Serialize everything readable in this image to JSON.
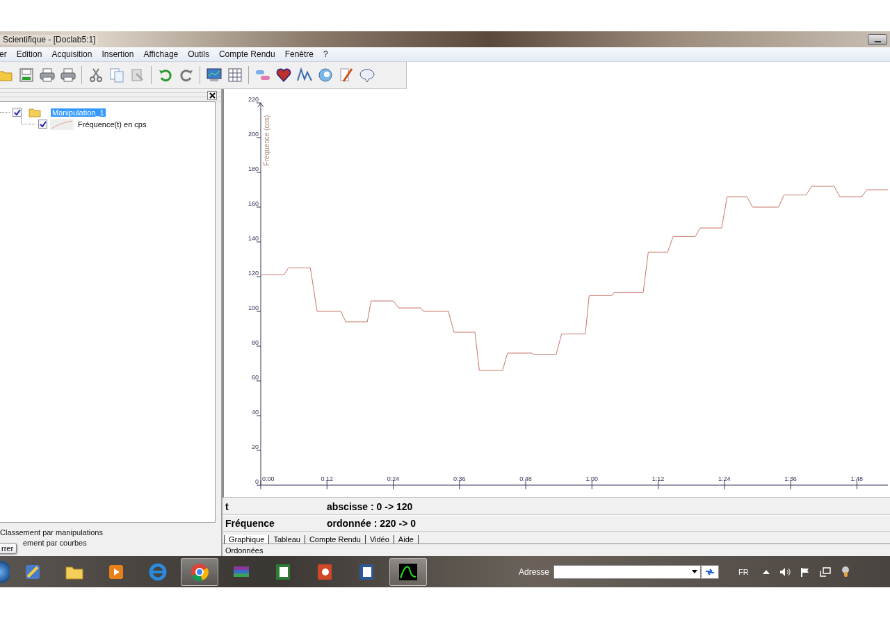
{
  "window": {
    "title": "Scientifique - [Doclab5:1]"
  },
  "menu": [
    "er",
    "Edition",
    "Acquisition",
    "Insertion",
    "Affichage",
    "Outils",
    "Compte Rendu",
    "Fenêtre",
    "?"
  ],
  "tree": [
    {
      "label": "Manipulation_1",
      "checked": true,
      "selected": true,
      "children": [
        {
          "label": "Fréquence(t) en cps",
          "checked": true,
          "selected": false
        }
      ]
    }
  ],
  "sort_options": [
    "Classement par manipulations",
    "ement par courbes"
  ],
  "tooltip": "rrer",
  "chart": {
    "chart_data": {
      "type": "line",
      "ylabel": "Fréquence (cps)",
      "xlim": [
        0,
        114
      ],
      "ylim": [
        0,
        220
      ],
      "xticks": [
        {
          "value": 0,
          "label": "0:00"
        },
        {
          "value": 12,
          "label": "0:12"
        },
        {
          "value": 24,
          "label": "0:24"
        },
        {
          "value": 36,
          "label": "0:36"
        },
        {
          "value": 48,
          "label": "0:48"
        },
        {
          "value": 60,
          "label": "1:00"
        },
        {
          "value": 72,
          "label": "1:12"
        },
        {
          "value": 84,
          "label": "1:24"
        },
        {
          "value": 96,
          "label": "1:36"
        },
        {
          "value": 108,
          "label": "1:48"
        }
      ],
      "yticks": [
        0,
        20,
        40,
        60,
        80,
        100,
        120,
        140,
        160,
        180,
        200,
        220
      ],
      "x": [
        0,
        4.2,
        5,
        9,
        10.2,
        14.5,
        15.4,
        19.3,
        20,
        24,
        25,
        29,
        29.5,
        34,
        35,
        38.8,
        39.6,
        43.8,
        44.7,
        49.1,
        49.5,
        53.5,
        54.5,
        58.8,
        59.5,
        63.6,
        64,
        69.3,
        70.2,
        73.7,
        74.7,
        78.7,
        79.6,
        83.5,
        84.5,
        88.1,
        89.1,
        93.8,
        94.8,
        98.8,
        99.8,
        103.9,
        104.9,
        108.9,
        109.8,
        114
      ],
      "series": [
        {
          "color": "#c87466",
          "values": [
            121,
            121,
            125,
            125,
            100,
            100,
            94,
            94,
            106,
            106,
            102,
            102,
            100,
            100,
            88,
            88,
            66,
            66,
            76,
            76,
            75,
            75,
            87,
            87,
            109,
            109,
            111,
            111,
            134,
            134,
            143,
            143,
            148,
            148,
            166,
            166,
            160,
            160,
            167,
            167,
            172,
            172,
            166,
            166,
            170,
            170
          ]
        }
      ]
    }
  },
  "axes_info": [
    {
      "name": "t",
      "range": "abscisse : 0 -> 120"
    },
    {
      "name": "Fréquence",
      "range": "ordonnée : 220 -> 0"
    }
  ],
  "tabs": [
    {
      "label": "Graphique",
      "selected": true
    },
    {
      "label": "Tableau",
      "selected": false
    },
    {
      "label": "Compte Rendu",
      "selected": false
    },
    {
      "label": "Vidéo",
      "selected": false
    },
    {
      "label": "Aide",
      "selected": false
    }
  ],
  "status_bar": "Ordonnées",
  "taskbar": {
    "apps": [
      {
        "running": false
      },
      {
        "running": false
      },
      {
        "running": false
      },
      {
        "running": false
      },
      {
        "running": true
      },
      {
        "running": false
      },
      {
        "running": false
      },
      {
        "running": false
      },
      {
        "running": false
      },
      {
        "running": true
      }
    ],
    "address_label": "Adresse",
    "language": "FR"
  }
}
